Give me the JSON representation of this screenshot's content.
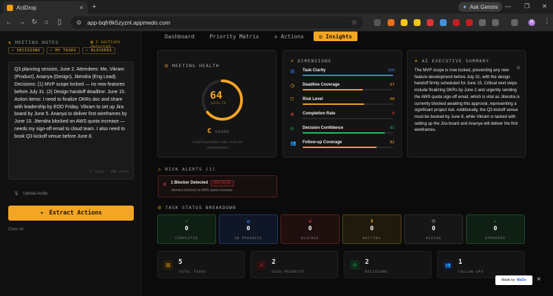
{
  "browser": {
    "tab_title": "ActDrop",
    "url": "app-bqfr8k5zyznl.appmedo.com",
    "gemini_label": "Ask Gemini",
    "profile_initial": "R"
  },
  "sidebar": {
    "section_title": "MEETING NOTES",
    "detected_note": "3 sections detected",
    "chips": [
      "DECISIONS",
      "MY TASKS",
      "BLOCKERS"
    ],
    "notes_text": "Q3 planning session, June 2. Attendees: Me, Vikram (Product), Ananya (Design), Jitendra (Eng Lead). Decisions: (1) MVP scope locked — no new features before July 31. (2) Design handoff deadline: June 15. Action items: I need to finalize OKRs doc and share with leadership by EOD Friday. Vikram to set up Jira board by June 5. Ananya to deliver first wireframes by June 10. Jitendra blocked on AWS quota increase — needs my sign-off email to cloud team. I also need to book Q3 kickoff venue before June 8.",
    "char_count": "1 lines · 386 chars",
    "upload_label": "Upload Audio",
    "extract_label": "Extract Actions",
    "clear_label": "Clear all"
  },
  "tabs": [
    {
      "label": "Dashboard",
      "active": false
    },
    {
      "label": "Priority Matrix",
      "active": false
    },
    {
      "label": "Actions",
      "active": false
    },
    {
      "label": "Insights",
      "active": true
    }
  ],
  "health": {
    "title": "MEETING HEALTH",
    "score": "64",
    "score_label": "HEALTH",
    "score_fraction": 0.64,
    "grade": "C",
    "grade_label": "GRADE",
    "description": "Solid foundation with room for improvement"
  },
  "dimensions": {
    "title": "DIMENSIONS",
    "items": [
      {
        "label": "Task Clarity",
        "value": "100",
        "fraction": 1.0,
        "color": "#3b82f6"
      },
      {
        "label": "Deadline Coverage",
        "value": "67",
        "fraction": 0.67,
        "color": "#f5a524"
      },
      {
        "label": "Risk Level",
        "value": "68",
        "fraction": 0.68,
        "color": "#f5a524"
      },
      {
        "label": "Completion Rate",
        "value": "0",
        "fraction": 0.0,
        "color": "#ef4444"
      },
      {
        "label": "Decision Confidence",
        "value": "91",
        "fraction": 0.91,
        "color": "#22c55e"
      },
      {
        "label": "Follow-up Coverage",
        "value": "82",
        "fraction": 0.82,
        "color": "#f5a524"
      }
    ]
  },
  "summary": {
    "title": "AI EXECUTIVE SUMMARY",
    "text": "The MVP scope is now locked, preventing any new feature development before July 31, with the design handoff firmly scheduled for June 15. Critical next steps include finalizing OKRs by June 2 and urgently sending the AWS quota sign-off email, which is vital as Jitendra is currently blocked awaiting this approval, representing a significant project risk. Additionally, the Q3 kickoff venue must be booked by June 8, while Vikram is tasked with setting up the Jira board and Ananya will deliver the first wireframes."
  },
  "risk": {
    "title": "RISK ALERTS (1)",
    "alert_title": "1 Blocker Detected",
    "alert_badge": "CRITICAL",
    "alert_sub": "Jitendra blocked on AWS quota increase"
  },
  "task_status": {
    "title": "TASK STATUS BREAKDOWN",
    "items": [
      {
        "label": "COMPLETED",
        "value": "0",
        "color": "#22c55e",
        "bg": "#0f1f14",
        "border": "#1f4a2a"
      },
      {
        "label": "IN PROGRESS",
        "value": "0",
        "color": "#3b82f6",
        "bg": "#0f1626",
        "border": "#1e3a66"
      },
      {
        "label": "BLOCKED",
        "value": "0",
        "color": "#ef4444",
        "bg": "#1f0f0f",
        "border": "#5a2222"
      },
      {
        "label": "WAITING",
        "value": "0",
        "color": "#f5a524",
        "bg": "#1f1a0c",
        "border": "#5a4a1a"
      },
      {
        "label": "REVIEW",
        "value": "0",
        "color": "#888888",
        "bg": "#161616",
        "border": "#2e2e2e"
      },
      {
        "label": "APPROVED",
        "value": "0",
        "color": "#22c55e",
        "bg": "#0f1f14",
        "border": "#1f4a2a"
      }
    ]
  },
  "totals": [
    {
      "label": "TOTAL TASKS",
      "value": "5",
      "color": "#f5a524",
      "bg": "#2a200c"
    },
    {
      "label": "HIGH PRIORITY",
      "value": "2",
      "color": "#ef4444",
      "bg": "#2a1010"
    },
    {
      "label": "DECISIONS",
      "value": "2",
      "color": "#22c55e",
      "bg": "#0f2a18"
    },
    {
      "label": "FOLLOW-UPS",
      "value": "1",
      "color": "#6366f1",
      "bg": "#161a2e"
    }
  ],
  "madeby": {
    "prefix": "Made by",
    "brand": "MeDo"
  }
}
